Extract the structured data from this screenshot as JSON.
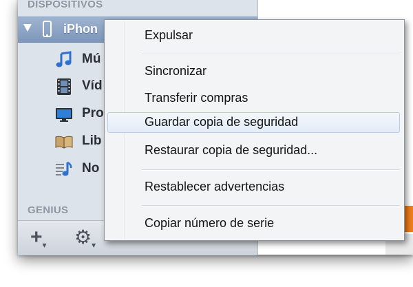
{
  "sidebar": {
    "section_devices": "DISPOSITIVOS",
    "section_genius": "GENIUS",
    "device": {
      "label": "iPhon"
    },
    "items": [
      {
        "label": "Mú",
        "icon": "music-icon"
      },
      {
        "label": "Víd",
        "icon": "film-icon"
      },
      {
        "label": "Pro",
        "icon": "tv-icon"
      },
      {
        "label": "Lib",
        "icon": "book-icon"
      },
      {
        "label": "No",
        "icon": "tones-icon"
      }
    ],
    "toolbar": {
      "add_icon": "plus-icon",
      "settings_icon": "gear-icon"
    }
  },
  "context_menu": {
    "items": [
      {
        "label": "Expulsar"
      },
      {
        "label": "Sincronizar"
      },
      {
        "label": "Transferir compras"
      },
      {
        "label": "Guardar copia de seguridad",
        "highlighted": true
      },
      {
        "label": "Restaurar copia de seguridad..."
      },
      {
        "label": "Restablecer advertencias"
      },
      {
        "label": "Copiar número de serie"
      }
    ]
  },
  "colors": {
    "accent_orange": "#ef7f1a",
    "selected_row": "#8aa1c4",
    "menu_highlight": "#e3ecf7"
  }
}
